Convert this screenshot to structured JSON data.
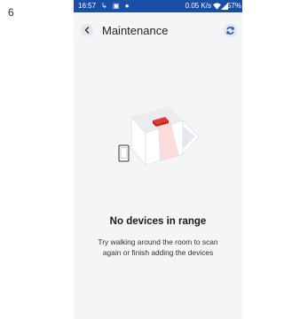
{
  "page": {
    "number": "6"
  },
  "status_bar": {
    "time": "16:57",
    "network_speed": "0.05 K/s",
    "battery": "57%"
  },
  "header": {
    "title": "Maintenance",
    "back_icon": "chevron-left-icon",
    "refresh_icon": "refresh-icon"
  },
  "empty_state": {
    "title": "No devices in range",
    "message": "Try walking around the room to scan again or finish adding the devices",
    "illustration": "room-scan-illustration"
  },
  "colors": {
    "status_bar": "#1b4ea6",
    "background": "#f4f5f7",
    "accent_red": "#e53935"
  }
}
